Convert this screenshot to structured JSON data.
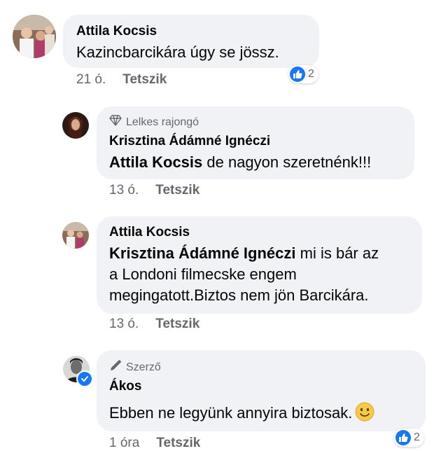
{
  "comments": [
    {
      "author": "Attila Kocsis",
      "text": "Kazincbarcikára úgy se jössz.",
      "time": "21 ó.",
      "like_label": "Tetszik",
      "reaction_count": "2"
    },
    {
      "badge": "Lelkes rajongó",
      "author": "Krisztina Ádámné Ignéczi",
      "mention": "Attila Kocsis",
      "text": " de nagyon szeretnénk!!!",
      "time": "13 ó.",
      "like_label": "Tetszik"
    },
    {
      "author": "Attila Kocsis",
      "mention": "Krisztina Ádámné Ignéczi",
      "line1": " mi is bár az",
      "line2": "a Londoni filmecske engem",
      "line3": "megingatott.Biztos nem jön Barcikára.",
      "time": "13 ó.",
      "like_label": "Tetszik"
    },
    {
      "badge": "Szerző",
      "author": "Ákos",
      "text": "Ebben ne legyünk annyira biztosak.",
      "time": "1 óra",
      "like_label": "Tetszik",
      "reaction_count": "2"
    }
  ],
  "colors": {
    "bubble": "#f0f2f5",
    "meta": "#65676b",
    "like_blue": "#1877f2"
  },
  "icons": [
    "diamond-icon",
    "pencil-icon",
    "thumbs-up-icon",
    "verified-icon",
    "smile-emoji-icon"
  ]
}
